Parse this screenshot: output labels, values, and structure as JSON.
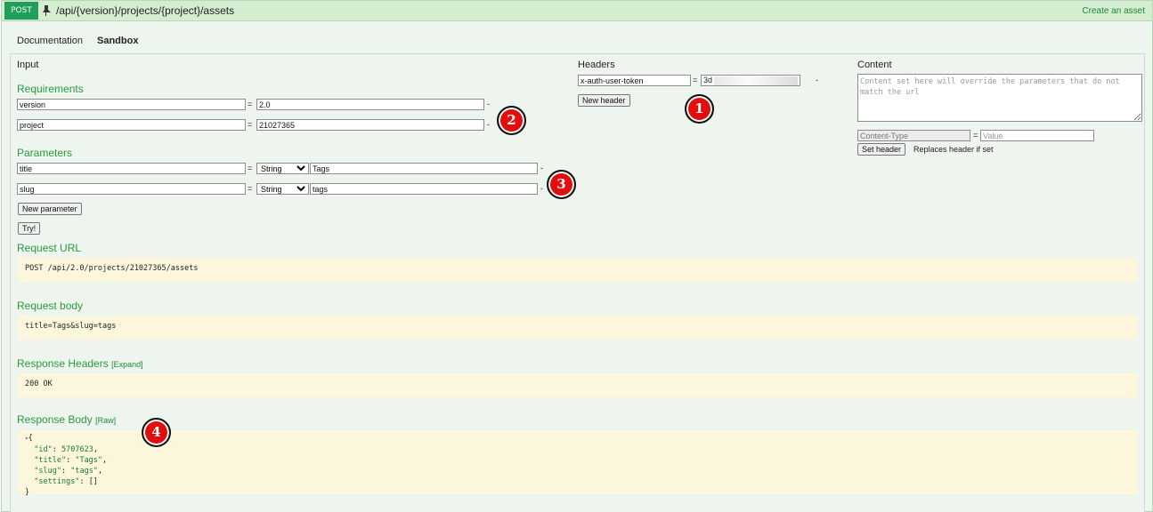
{
  "endpoint": {
    "method": "POST",
    "path": "/api/{version}/projects/{project}/assets",
    "description": "Create an asset",
    "method_color": "#1f9f5a"
  },
  "tabs": [
    {
      "label": "Documentation",
      "active": false
    },
    {
      "label": "Sandbox",
      "active": true
    }
  ],
  "input": {
    "title": "Input",
    "requirements": {
      "title": "Requirements",
      "rows": [
        {
          "name": "version",
          "value": "2.0"
        },
        {
          "name": "project",
          "value": "21027365"
        }
      ]
    },
    "parameters": {
      "title": "Parameters",
      "rows": [
        {
          "name": "title",
          "type": "String",
          "value": "Tags"
        },
        {
          "name": "slug",
          "type": "String",
          "value": "tags"
        }
      ],
      "new_button": "New parameter"
    },
    "try_button": "Try!",
    "equals": "=",
    "remove": "-"
  },
  "headers": {
    "title": "Headers",
    "rows": [
      {
        "name": "x-auth-user-token",
        "value": "3d"
      }
    ],
    "new_button": "New header"
  },
  "content": {
    "title": "Content",
    "placeholder": "Content set here will override the parameters that do not match the url",
    "content_type_value": "Content-Type",
    "value_placeholder": "Value",
    "set_button": "Set header",
    "note": "Replaces header if set"
  },
  "results": {
    "request_url": {
      "title": "Request URL",
      "value": "POST /api/2.0/projects/21027365/assets"
    },
    "request_body": {
      "title": "Request body",
      "value": "title=Tags&slug=tags"
    },
    "response_headers": {
      "title": "Response Headers",
      "toggle": "[Expand]",
      "value": "200 OK"
    },
    "response_body": {
      "title": "Response Body",
      "toggle": "[Raw]",
      "open": "{",
      "lines": [
        {
          "key": "\"id\"",
          "value": "5707623"
        },
        {
          "key": "\"title\"",
          "value": "\"Tags\""
        },
        {
          "key": "\"slug\"",
          "value": "\"tags\""
        },
        {
          "key": "\"settings\"",
          "value": "[]"
        }
      ],
      "close": "}"
    }
  },
  "badges": [
    "1",
    "2",
    "3",
    "4"
  ]
}
